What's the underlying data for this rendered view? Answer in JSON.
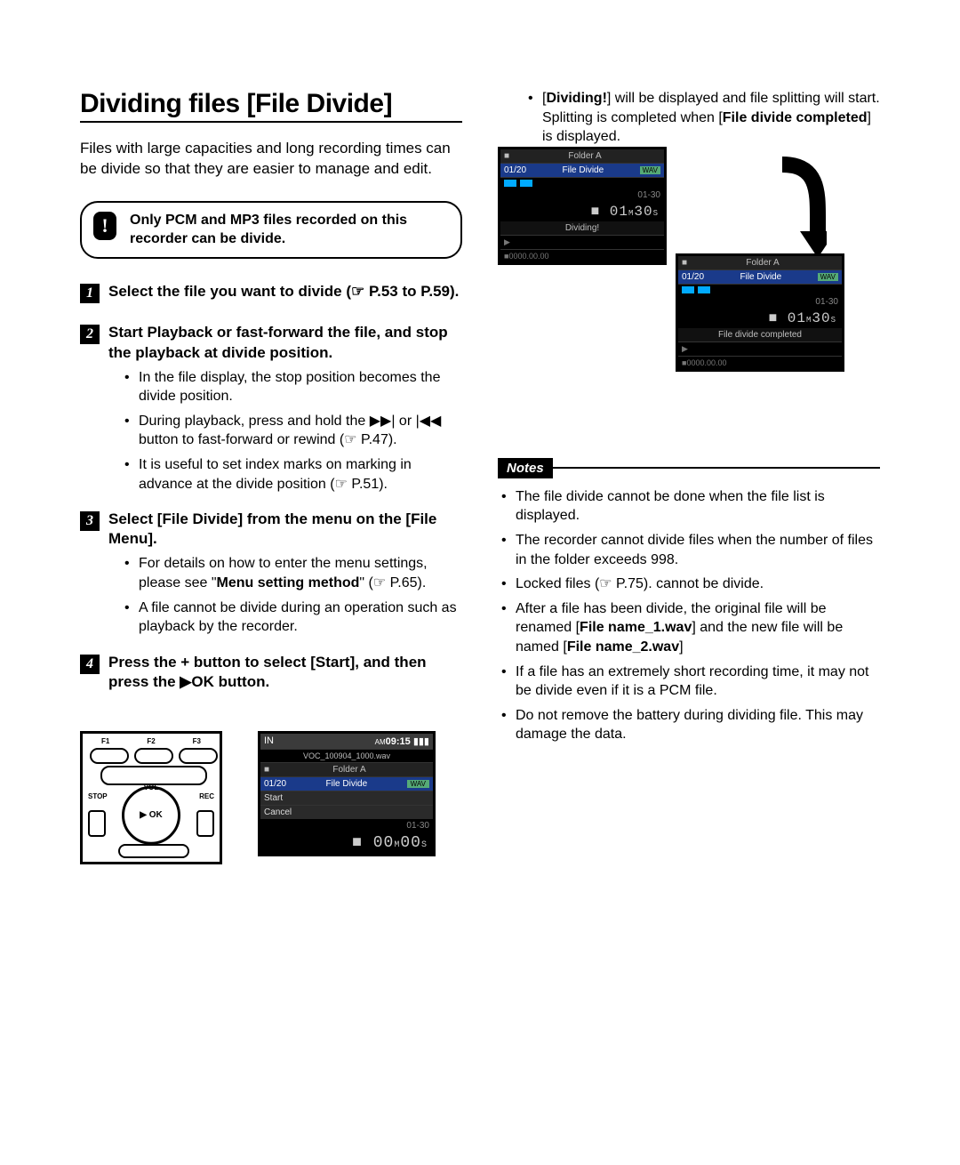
{
  "title": "Dividing files [File Divide]",
  "intro": "Files with large capacities and long recording times can be divide so that they are easier to manage and edit.",
  "noticebox": {
    "text": "Only PCM and MP3 files recorded on this recorder can be divide."
  },
  "steps": [
    {
      "num": "1",
      "title_html": "Select the file you want to divide (☞ P.53 to P.59).",
      "bullets": []
    },
    {
      "num": "2",
      "title_html": "Start Playback or fast-forward the file, and stop the playback at divide position.",
      "bullets": [
        "In the file display, the stop position becomes the divide position.",
        "During playback, press and hold the ▶▶| or |◀◀ button to fast-forward or rewind (☞ P.47).",
        "It is useful to set index marks on marking in advance at the divide position (☞ P.51)."
      ]
    },
    {
      "num": "3",
      "title_html": "Select [<b>File Divide</b>] from the menu on the [<b>File Menu</b>].",
      "bullets": [
        "For details on how to enter the menu settings, please see \"<b>Menu setting method</b>\" (☞ P.65).",
        "A file cannot be divide during an operation such as playback by the recorder."
      ]
    },
    {
      "num": "4",
      "title_html": "Press the + button to select [<b>Start</b>], and then press the ▶<b>OK</b> button.",
      "bullets": []
    }
  ],
  "right_top_html": "[<b>Dividing!</b>] will be displayed and file splitting will start. Splitting is completed when [<b>File divide completed</b>] is displayed.",
  "lcd1": {
    "folder": "Folder A",
    "track": "01/20",
    "mode": "File Divide",
    "fmt": "WAV",
    "date": "01-30",
    "time": "01M30S",
    "status": "Dividing!",
    "counter": "0000.00.00"
  },
  "lcd2": {
    "folder": "Folder A",
    "track": "01/20",
    "mode": "File Divide",
    "fmt": "WAV",
    "date": "01-30",
    "time": "01M30S",
    "status": "File divide completed",
    "counter": "0000.00.00"
  },
  "notes_label": "Notes",
  "notes": [
    "The file divide cannot be done when the file list is displayed.",
    "The recorder cannot divide files when the number of files in the folder exceeds 998.",
    "Locked files (☞ P.75). cannot be divide.",
    "After a file has been divide, the original file will be renamed [<b>File name_1.wav</b>] and the new file will be named [<b>File name_2.wav</b>]",
    "If a file has an extremely short recording time, it may not be divide even if it is a PCM file.",
    "Do not remove the battery during dividing file. This may damage the data."
  ],
  "recorder": {
    "f1": "F1",
    "f2": "F2",
    "f3": "F3",
    "stop": "STOP",
    "rec": "REC",
    "ok": "▶ OK",
    "vol": "VOL"
  },
  "lcd_bottom": {
    "card": "IN",
    "clock": "09:15",
    "batt": "▮▮▮",
    "filename": "VOC_100904_1000.wav",
    "folder": "Folder A",
    "track": "01/20",
    "mode": "File Divide",
    "fmt": "WAV",
    "opt1": "Start",
    "opt2": "Cancel",
    "date": "01-30",
    "time": "00M00S"
  }
}
